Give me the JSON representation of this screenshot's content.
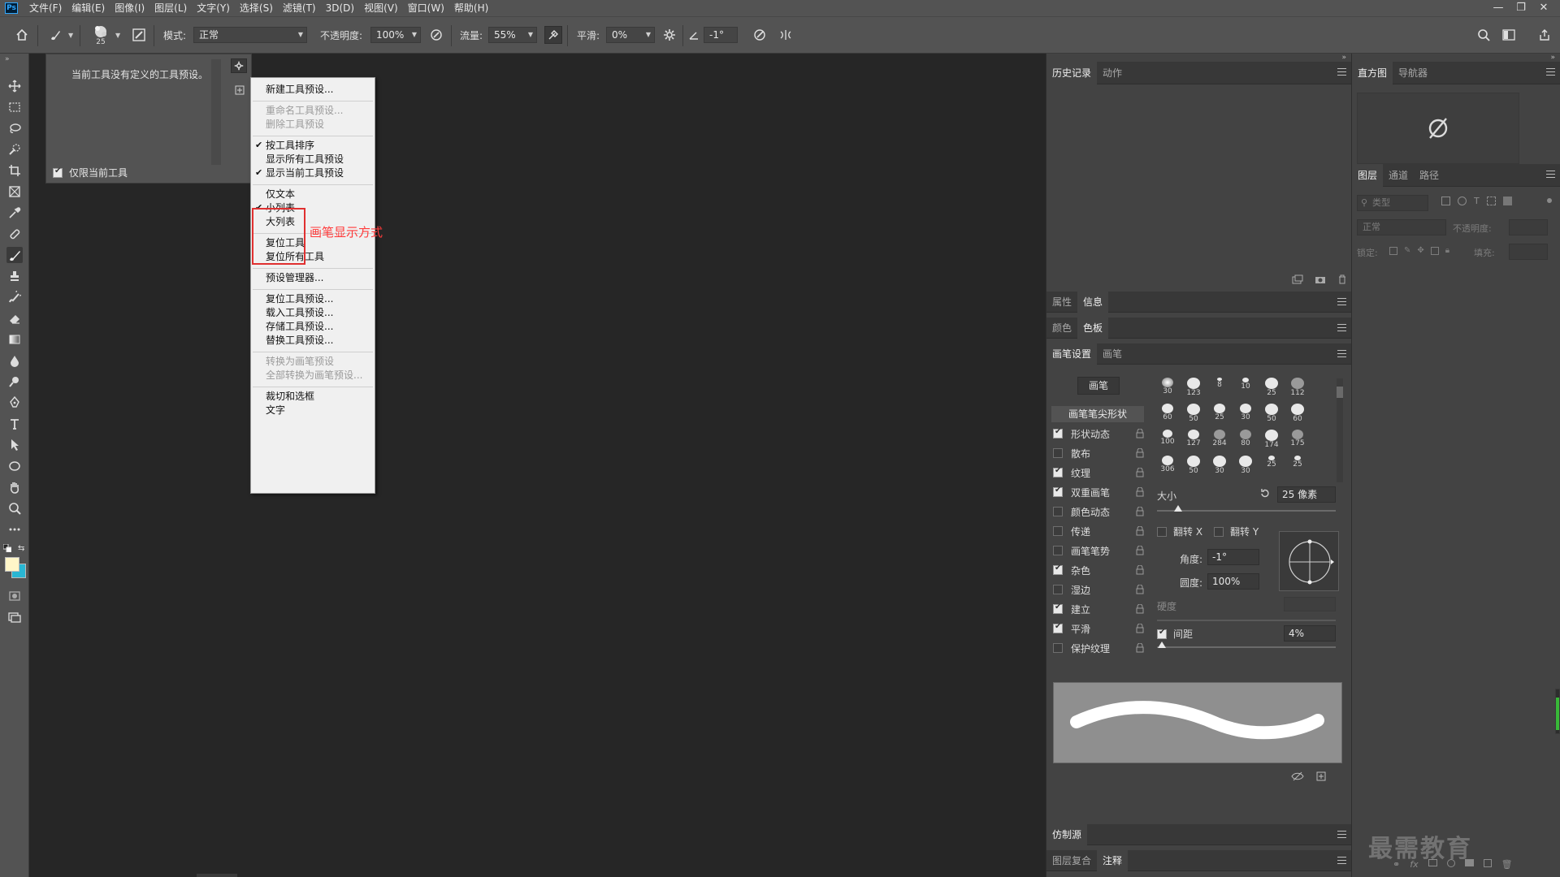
{
  "menubar": {
    "logo": "Ps",
    "items": [
      "文件(F)",
      "编辑(E)",
      "图像(I)",
      "图层(L)",
      "文字(Y)",
      "选择(S)",
      "滤镜(T)",
      "3D(D)",
      "视图(V)",
      "窗口(W)",
      "帮助(H)"
    ],
    "window_controls": [
      "—",
      "❐",
      "✕"
    ]
  },
  "options": {
    "brush_size": "25",
    "mode_label": "模式:",
    "mode_value": "正常",
    "opacity_label": "不透明度:",
    "opacity_value": "100%",
    "flow_label": "流量:",
    "flow_value": "55%",
    "smooth_label": "平滑:",
    "smooth_value": "0%",
    "angle_value": "-1°"
  },
  "preset_panel": {
    "empty_message": "当前工具没有定义的工具预设。",
    "only_current_label": "仅限当前工具",
    "only_current_checked": true
  },
  "context_menu": {
    "items": [
      {
        "label": "新建工具预设...",
        "disabled": false,
        "checked": false
      },
      {
        "label": "重命名工具预设...",
        "disabled": true,
        "checked": false
      },
      {
        "label": "删除工具预设",
        "disabled": true,
        "checked": false
      },
      {
        "label": "按工具排序",
        "disabled": false,
        "checked": true
      },
      {
        "label": "显示所有工具预设",
        "disabled": false,
        "checked": false
      },
      {
        "label": "显示当前工具预设",
        "disabled": false,
        "checked": true
      },
      {
        "label": "仅文本",
        "disabled": false,
        "checked": false
      },
      {
        "label": "小列表",
        "disabled": false,
        "checked": true
      },
      {
        "label": "大列表",
        "disabled": false,
        "checked": false
      },
      {
        "label": "复位工具",
        "disabled": false,
        "checked": false
      },
      {
        "label": "复位所有工具",
        "disabled": false,
        "checked": false
      },
      {
        "label": "预设管理器...",
        "disabled": false,
        "checked": false
      },
      {
        "label": "复位工具预设...",
        "disabled": false,
        "checked": false
      },
      {
        "label": "载入工具预设...",
        "disabled": false,
        "checked": false
      },
      {
        "label": "存储工具预设...",
        "disabled": false,
        "checked": false
      },
      {
        "label": "替换工具预设...",
        "disabled": false,
        "checked": false
      },
      {
        "label": "转换为画笔预设",
        "disabled": true,
        "checked": false
      },
      {
        "label": "全部转换为画笔预设...",
        "disabled": true,
        "checked": false
      },
      {
        "label": "裁切和选框",
        "disabled": false,
        "checked": false
      },
      {
        "label": "文字",
        "disabled": false,
        "checked": false
      }
    ],
    "annotation": "画笔显示方式",
    "annotation_color": "#ff3a3a"
  },
  "panels": {
    "history_tabs": [
      "历史记录",
      "动作"
    ],
    "properties_tabs": [
      "属性",
      "信息"
    ],
    "color_tabs": [
      "颜色",
      "色板"
    ],
    "brush_tabs": [
      "画笔设置",
      "画笔"
    ],
    "clone_tabs": [
      "仿制源"
    ],
    "comp_tabs": [
      "图层复合",
      "注释"
    ],
    "histogram_tabs": [
      "直方图",
      "导航器"
    ],
    "layers_tabs": [
      "图层",
      "通道",
      "路径"
    ]
  },
  "brush_settings": {
    "brush_button": "画笔",
    "tip_shape_label": "画笔笔尖形状",
    "options": [
      {
        "label": "形状动态",
        "checked": true
      },
      {
        "label": "散布",
        "checked": false
      },
      {
        "label": "纹理",
        "checked": true
      },
      {
        "label": "双重画笔",
        "checked": true
      },
      {
        "label": "颜色动态",
        "checked": false
      },
      {
        "label": "传递",
        "checked": false
      },
      {
        "label": "画笔笔势",
        "checked": false
      },
      {
        "label": "杂色",
        "checked": true
      },
      {
        "label": "湿边",
        "checked": false
      },
      {
        "label": "建立",
        "checked": true
      },
      {
        "label": "平滑",
        "checked": true
      },
      {
        "label": "保护纹理",
        "checked": false
      }
    ],
    "tips": [
      "30",
      "123",
      "8",
      "10",
      "25",
      "112",
      "60",
      "50",
      "25",
      "30",
      "50",
      "60",
      "100",
      "127",
      "284",
      "80",
      "174",
      "175",
      "306",
      "50",
      "30",
      "30",
      "25",
      "25"
    ],
    "size_label": "大小",
    "size_value": "25 像素",
    "flip_x": "翻转 X",
    "flip_y": "翻转 Y",
    "angle_label": "角度:",
    "angle_value": "-1°",
    "roundness_label": "圆度:",
    "roundness_value": "100%",
    "hardness_label": "硬度",
    "spacing_label": "间距",
    "spacing_value": "4%",
    "spacing_checked": true
  },
  "layers": {
    "filter_placeholder": "类型",
    "blend_mode": "正常",
    "opacity_label": "不透明度:",
    "lock_label": "锁定:",
    "fill_label": "填充:"
  },
  "watermark": "最需教育",
  "colors": {
    "foreground": "#fff6c8",
    "background": "#29b6d3"
  }
}
